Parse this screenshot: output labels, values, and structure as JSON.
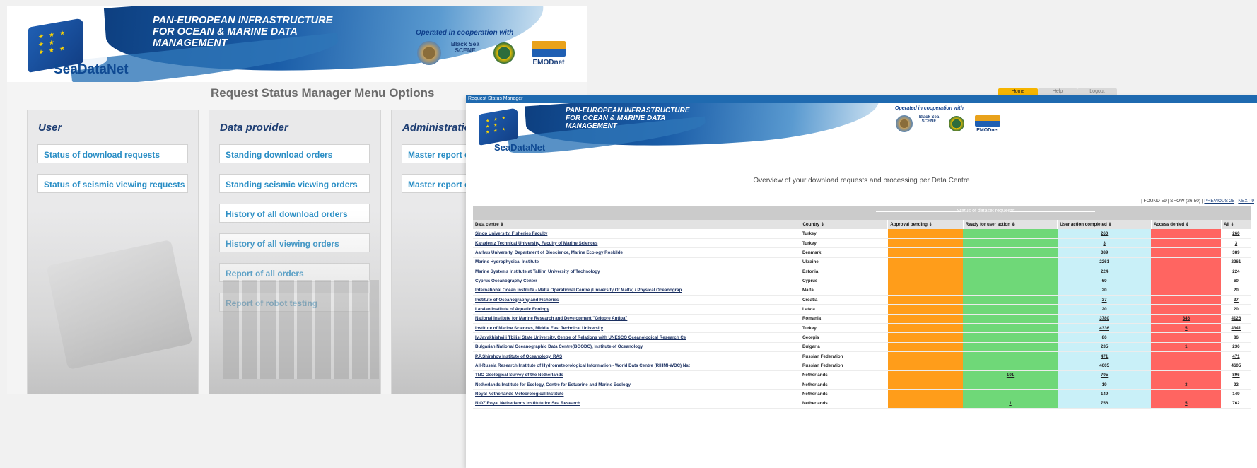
{
  "banner": {
    "title_lines": [
      "PAN-EUROPEAN INFRASTRUCTURE",
      "FOR OCEAN & MARINE DATA",
      "MANAGEMENT"
    ],
    "logo_text": "SeaDataNet",
    "coop_text": "Operated in cooperation with",
    "partners": [
      "Geo-Seas",
      "Black Sea SCENE",
      "UBSS",
      "EMODnet"
    ]
  },
  "menu": {
    "heading": "Request Status Manager Menu Options",
    "panels": [
      {
        "title": "User",
        "items": [
          "Status of download requests",
          "Status of seismic viewing requests"
        ]
      },
      {
        "title": "Data provider",
        "items": [
          "Standing download orders",
          "Standing seismic viewing orders",
          "History of all download orders",
          "History of all viewing orders",
          "Report of all orders",
          "Report of robot testing"
        ]
      },
      {
        "title": "Administratio",
        "items": [
          "Master report of a",
          "Master report of"
        ]
      }
    ]
  },
  "front": {
    "window_title": "Request Status Manager",
    "nav": [
      "Home",
      "Help",
      "Logout"
    ],
    "overview": "Overview of your download requests and processing per Data Centre",
    "pager": {
      "found": "| FOUND 59 | SHOW (26-50) |",
      "previous": "PREVIOUS 25",
      "next": "NEXT 9"
    },
    "status_group": "Status of dataset requests",
    "columns": [
      "Data centre ⇕",
      "Country ⇕",
      "Approval pending ⇕",
      "Ready for user action ⇕",
      "User action completed ⇕",
      "Access denied ⇕",
      "All ⇕"
    ],
    "rows": [
      {
        "centre": "Sinop University, Fisheries Faculty",
        "country": "Turkey",
        "ready": "",
        "done": "260",
        "denied": "",
        "all": "260",
        "link": true
      },
      {
        "centre": "Karadeniz Technical University, Faculty of Marine Sciences",
        "country": "Turkey",
        "ready": "",
        "done": "3",
        "denied": "",
        "all": "3",
        "link": true
      },
      {
        "centre": "Aarhus University, Department of Bioscience, Marine Ecology Roskilde",
        "country": "Denmark",
        "ready": "",
        "done": "389",
        "denied": "",
        "all": "389",
        "link": true
      },
      {
        "centre": "Marine Hydrophysical Institute",
        "country": "Ukraine",
        "ready": "",
        "done": "2261",
        "denied": "",
        "all": "2261",
        "link": true
      },
      {
        "centre": "Marine Systems Institute at Tallinn University of Technology",
        "country": "Estonia",
        "ready": "",
        "done": "224",
        "denied": "",
        "all": "224",
        "link": false
      },
      {
        "centre": "Cyprus Oceanography Center",
        "country": "Cyprus",
        "ready": "",
        "done": "60",
        "denied": "",
        "all": "60",
        "link": false
      },
      {
        "centre": "International Ocean Institute - Malta Operational Centre (University Of Malta) / Physical Oceanograp",
        "country": "Malta",
        "ready": "",
        "done": "20",
        "denied": "",
        "all": "20",
        "link": false
      },
      {
        "centre": "Institute of Oceanography and Fisheries",
        "country": "Croatia",
        "ready": "",
        "done": "37",
        "denied": "",
        "all": "37",
        "link": true
      },
      {
        "centre": "Latvian Institute of Aquatic Ecology",
        "country": "Latvia",
        "ready": "",
        "done": "20",
        "denied": "",
        "all": "20",
        "link": false
      },
      {
        "centre": "National Institute for Marine Research and Development \"Grigore Antipa\"",
        "country": "Romania",
        "ready": "",
        "done": "3780",
        "denied": "346",
        "all": "4126",
        "link": true
      },
      {
        "centre": "Institute of Marine Sciences, Middle East Technical University",
        "country": "Turkey",
        "ready": "",
        "done": "4336",
        "denied": "5",
        "all": "4341",
        "link": true
      },
      {
        "centre": "Iv.Javakhishvili Tbilisi State University, Centre of Relations with UNESCO Oceanological Research Ce",
        "country": "Georgia",
        "ready": "",
        "done": "86",
        "denied": "",
        "all": "86",
        "link": false
      },
      {
        "centre": "Bulgarian National Oceanographic Data Centre(BGODC), Institute of Oceanology",
        "country": "Bulgaria",
        "ready": "",
        "done": "235",
        "denied": "1",
        "all": "236",
        "link": true
      },
      {
        "centre": "P.P.Shirshov Institute of Oceanology, RAS",
        "country": "Russian Federation",
        "ready": "",
        "done": "471",
        "denied": "",
        "all": "471",
        "link": true
      },
      {
        "centre": "All-Russia Research Institute of Hydrometeorological Information - World Data Centre (RIHMI-WDC) Nat",
        "country": "Russian Federation",
        "ready": "",
        "done": "4605",
        "denied": "",
        "all": "4605",
        "link": true
      },
      {
        "centre": "TNO Geological Survey of the Netherlands",
        "country": "Netherlands",
        "ready": "101",
        "done": "795",
        "denied": "",
        "all": "896",
        "link": true
      },
      {
        "centre": "Netherlands Institute for Ecology, Centre for Estuarine and Marine Ecology",
        "country": "Netherlands",
        "ready": "",
        "done": "19",
        "denied": "3",
        "all": "22",
        "link": false
      },
      {
        "centre": "Royal Netherlands Meteorological Institute",
        "country": "Netherlands",
        "ready": "",
        "done": "149",
        "denied": "",
        "all": "149",
        "link": false
      },
      {
        "centre": "NIOZ Royal Netherlands Institute for Sea Research",
        "country": "Netherlands",
        "ready": "1",
        "done": "756",
        "denied": "5",
        "all": "762",
        "link": false
      }
    ]
  }
}
